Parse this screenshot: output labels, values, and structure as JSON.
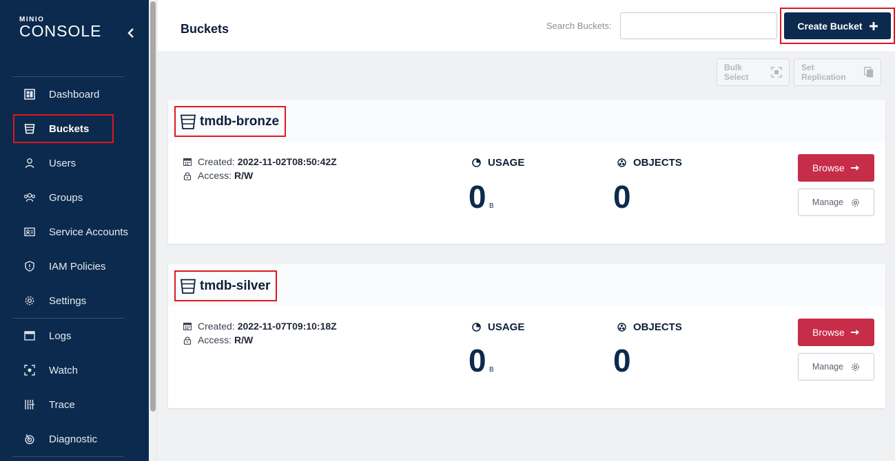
{
  "app": {
    "brand_top": "MINIO",
    "brand_bottom": "CONSOLE"
  },
  "sidebar": {
    "items": [
      {
        "label": "Dashboard",
        "icon": "dashboard-icon"
      },
      {
        "label": "Buckets",
        "icon": "bucket-icon",
        "active": true
      },
      {
        "label": "Users",
        "icon": "user-icon"
      },
      {
        "label": "Groups",
        "icon": "groups-icon"
      },
      {
        "label": "Service Accounts",
        "icon": "service-account-icon"
      },
      {
        "label": "IAM Policies",
        "icon": "shield-icon"
      },
      {
        "label": "Settings",
        "icon": "gear-icon"
      },
      {
        "label": "Logs",
        "icon": "logs-icon"
      },
      {
        "label": "Watch",
        "icon": "watch-icon"
      },
      {
        "label": "Trace",
        "icon": "trace-icon"
      },
      {
        "label": "Diagnostic",
        "icon": "diagnostic-icon"
      }
    ]
  },
  "header": {
    "title": "Buckets",
    "search_label": "Search Buckets:",
    "search_value": "",
    "create_label": "Create Bucket"
  },
  "toolbar": {
    "bulk_select": "Bulk Select",
    "set_replication": "Set Replication"
  },
  "buckets": [
    {
      "name": "tmdb-bronze",
      "created_label": "Created:",
      "created": "2022-11-02T08:50:42Z",
      "access_label": "Access:",
      "access": "R/W",
      "usage_label": "USAGE",
      "usage_value": "0",
      "usage_unit": "B",
      "objects_label": "OBJECTS",
      "objects_value": "0",
      "browse_label": "Browse",
      "manage_label": "Manage"
    },
    {
      "name": "tmdb-silver",
      "created_label": "Created:",
      "created": "2022-11-07T09:10:18Z",
      "access_label": "Access:",
      "access": "R/W",
      "usage_label": "USAGE",
      "usage_value": "0",
      "usage_unit": "B",
      "objects_label": "OBJECTS",
      "objects_value": "0",
      "browse_label": "Browse",
      "manage_label": "Manage"
    }
  ],
  "colors": {
    "sidebar_bg": "#0c2a4d",
    "primary_dark": "#0c2a4d",
    "browse_red": "#c72c48",
    "highlight_red": "#e0161f"
  }
}
